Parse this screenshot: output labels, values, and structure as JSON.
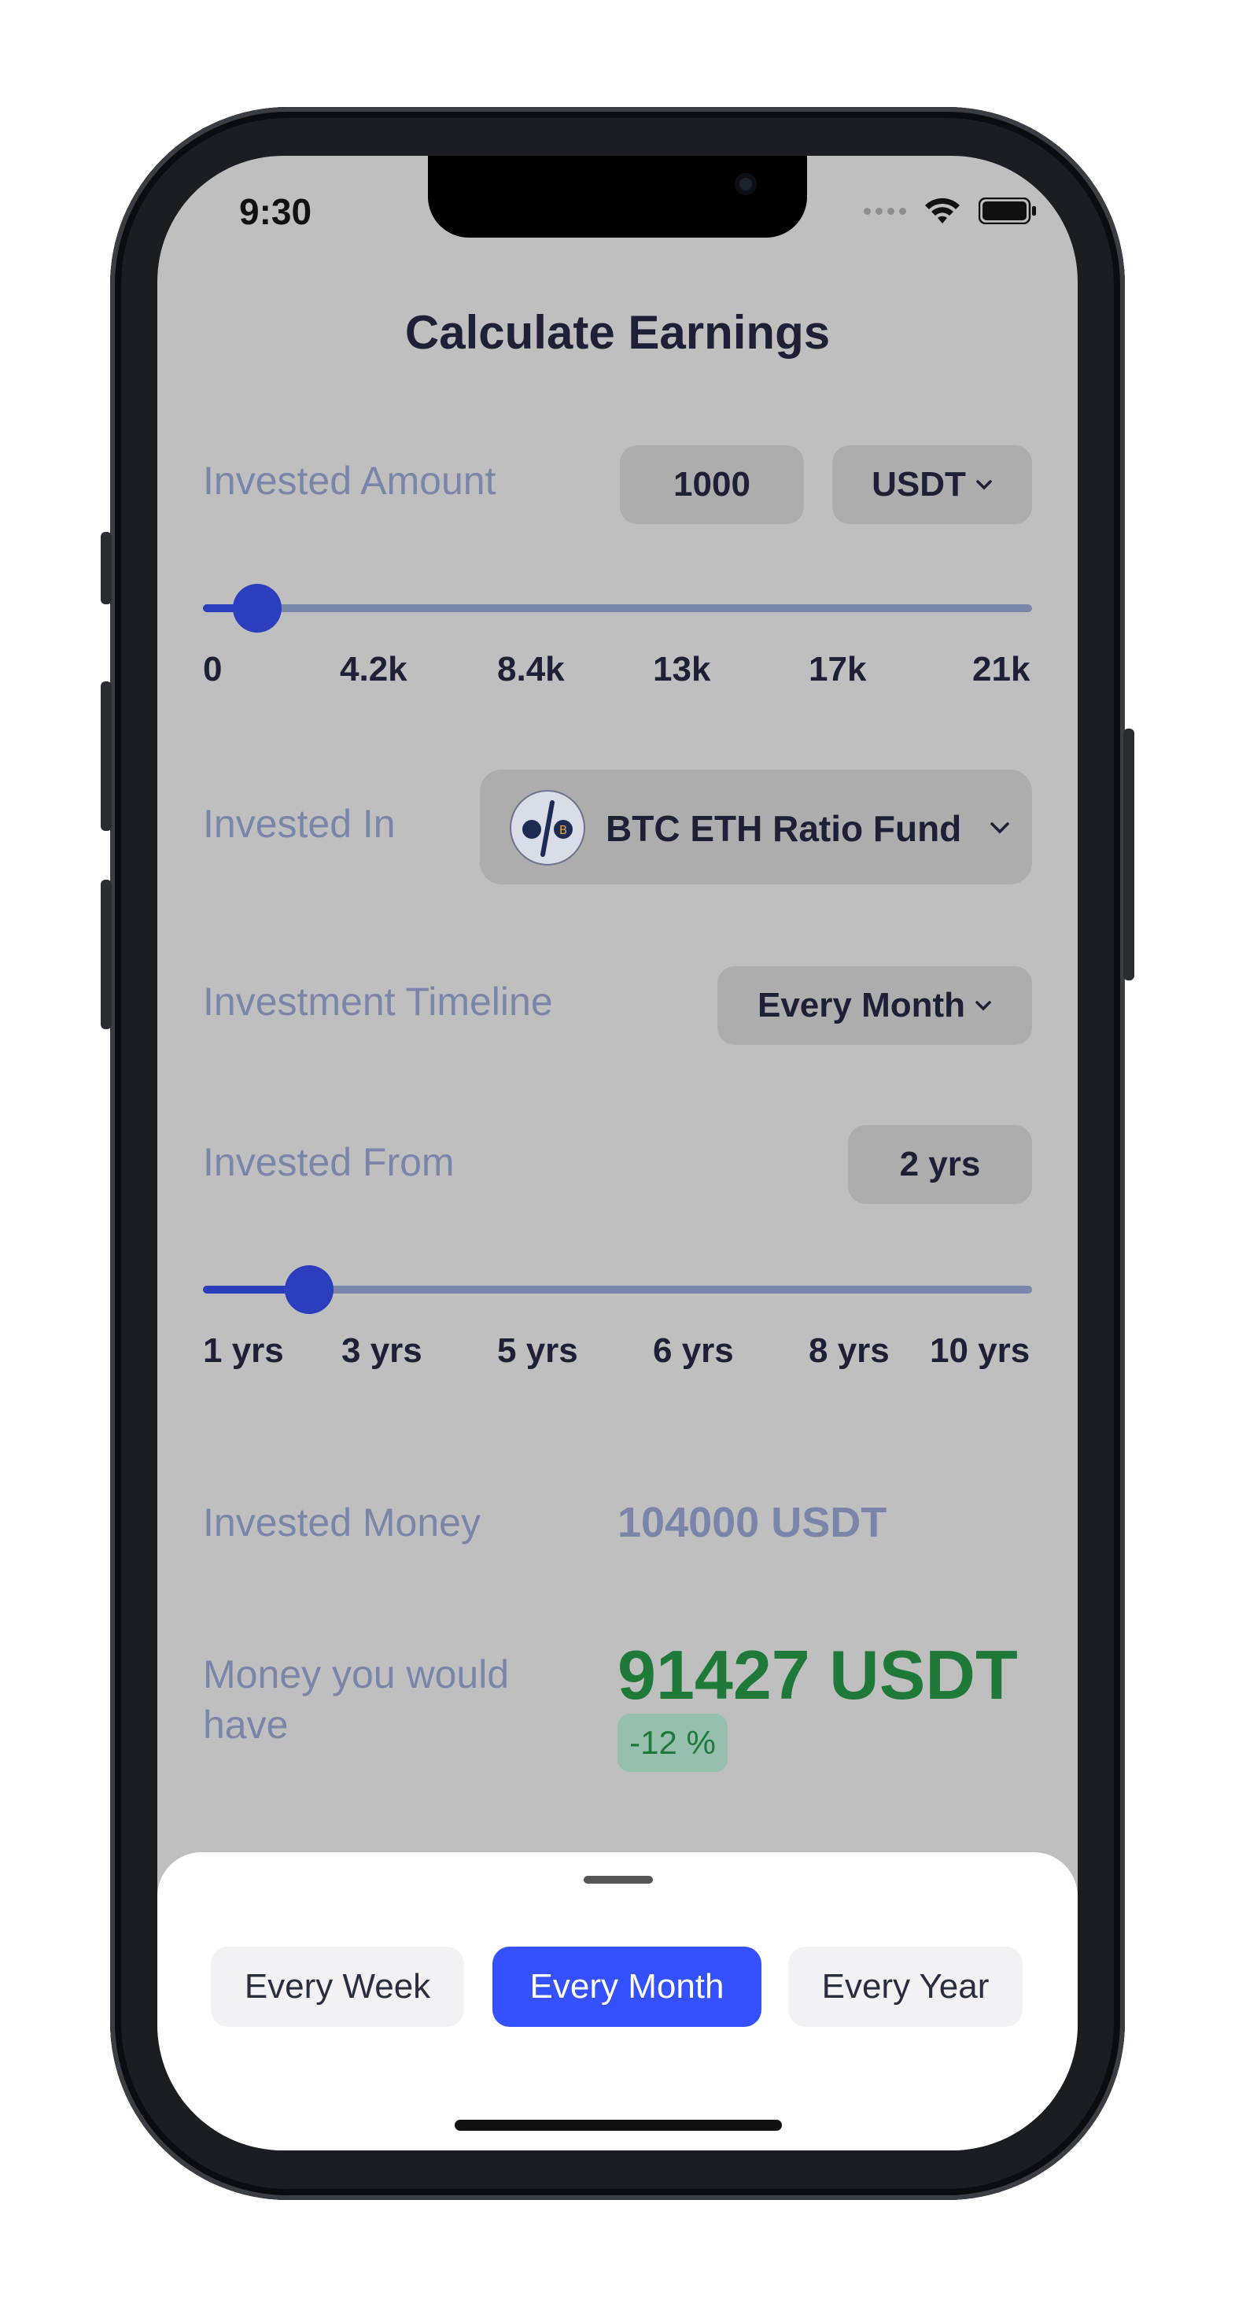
{
  "status_bar": {
    "time": "9:30"
  },
  "header": {
    "title": "Calculate Earnings"
  },
  "invested_amount": {
    "label": "Invested Amount",
    "value": "1000",
    "currency": "USDT",
    "slider_fraction": 0.048,
    "ticks": [
      "0",
      "4.2k",
      "8.4k",
      "13k",
      "17k",
      "21k"
    ]
  },
  "invested_in": {
    "label": "Invested In",
    "fund": "BTC ETH Ratio Fund"
  },
  "timeline": {
    "label": "Investment Timeline",
    "value": "Every Month"
  },
  "invested_from": {
    "label": "Invested From",
    "value": "2 yrs",
    "slider_fraction": 0.111,
    "ticks": [
      "1 yrs",
      "3 yrs",
      "5 yrs",
      "6 yrs",
      "8 yrs",
      "10 yrs"
    ]
  },
  "results": {
    "invested_money_label": "Invested Money",
    "invested_money_value": "104000 USDT",
    "would_have_label": "Money you would have",
    "would_have_value": "91427 USDT",
    "change": "-12 %"
  },
  "sheet": {
    "options": [
      "Every Week",
      "Every Month",
      "Every Year"
    ],
    "selected": "Every Month"
  },
  "colors": {
    "accent": "#3550ff",
    "slider": "#2b3fbe",
    "positive_text": "#1f7a3a",
    "muted_label": "#7a85aa"
  }
}
